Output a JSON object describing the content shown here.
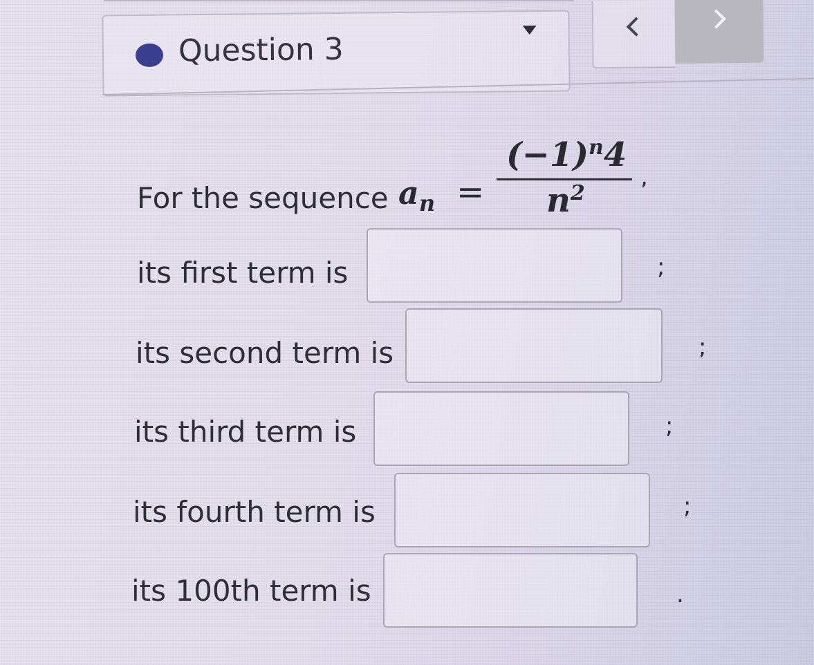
{
  "header": {
    "question_label": "Question 3"
  },
  "problem": {
    "intro": "For the sequence",
    "sequence_var": "a",
    "sequence_sub": "n",
    "equals": "=",
    "numerator_base": "(−1)",
    "numerator_exp": "n",
    "numerator_tail": "4",
    "denominator_base": "n",
    "denominator_exp": "2",
    "trailing": ","
  },
  "answers": [
    {
      "label": "its first term is",
      "value": "",
      "punct": ";"
    },
    {
      "label": "its second term is",
      "value": "",
      "punct": ";"
    },
    {
      "label": "its third term is",
      "value": "",
      "punct": ";"
    },
    {
      "label": "its fourth term is",
      "value": "",
      "punct": ";"
    },
    {
      "label": "its 100th term is",
      "value": "",
      "punct": "."
    }
  ],
  "colors": {
    "status_dot": "#3a3f8f",
    "next_button": "#b8b6bf"
  }
}
